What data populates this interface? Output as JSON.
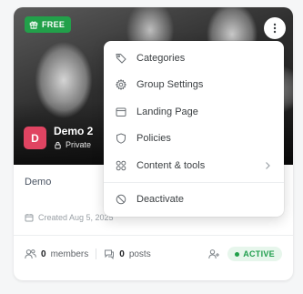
{
  "card": {
    "badge_label": "FREE",
    "group_initial": "D",
    "group_name": "Demo 2",
    "privacy_label": "Private",
    "description": "Demo",
    "created_label": "Created Aug 5, 2025",
    "members_count": "0",
    "members_label": "members",
    "posts_count": "0",
    "posts_label": "posts",
    "status_label": "ACTIVE"
  },
  "menu": {
    "items": [
      {
        "label": "Categories",
        "icon": "tag-icon"
      },
      {
        "label": "Group Settings",
        "icon": "gear-icon"
      },
      {
        "label": "Landing Page",
        "icon": "browser-window-icon"
      },
      {
        "label": "Policies",
        "icon": "shield-icon"
      },
      {
        "label": "Content & tools",
        "icon": "grid-icon"
      }
    ],
    "deactivate_label": "Deactivate",
    "deactivate_icon": "ban-icon"
  },
  "colors": {
    "free_badge": "#22a04a",
    "avatar": "#e04462",
    "active_text": "#1f9d4c",
    "active_bg": "#e7f6ec"
  }
}
